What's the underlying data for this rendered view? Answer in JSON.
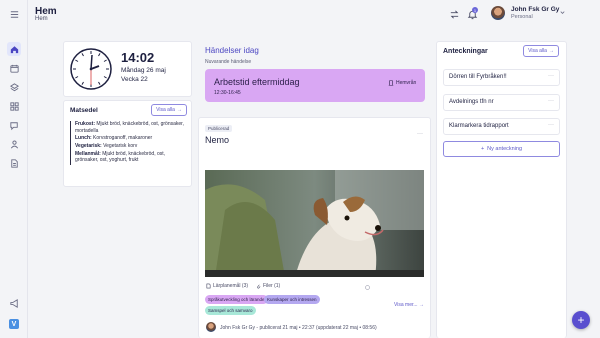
{
  "header": {
    "title": "Hem",
    "breadcrumb": "Hem",
    "notification_count": "1",
    "user_name": "John Fsk Gr Gy",
    "user_role": "Personal"
  },
  "sidebar": {
    "icons": [
      "menu-icon",
      "home-icon",
      "calendar-icon",
      "layers-icon",
      "grid-icon",
      "chat-icon",
      "people-icon",
      "document-icon",
      "megaphone-icon"
    ],
    "logo": "V"
  },
  "clock": {
    "time": "14:02",
    "date": "Måndag 26 maj",
    "week": "Vecka 22"
  },
  "menu": {
    "title": "Matsedel",
    "show_all": "Visa alla",
    "items": [
      {
        "label": "Frukost:",
        "text": " Mjukt bröd, knäckebröd, ost, grönsaker, mortadella"
      },
      {
        "label": "Lunch:",
        "text": " Korvstroganoff, makaroner"
      },
      {
        "label": "Vegetarisk:",
        "text": " Vegetarisk korv"
      },
      {
        "label": "Mellanmål:",
        "text": " Mjukt bröd, knäckebröd, ost, grönsaker, ost, yoghurt, frukt"
      }
    ]
  },
  "events": {
    "title": "Händelser idag",
    "subtitle": "Nuvarande händelse",
    "current": {
      "title": "Arbetstid eftermiddag",
      "time": "12:30-16:45",
      "room": "Hemvrån",
      "color": "#d9a7f3"
    }
  },
  "post": {
    "badge": "Publicerad",
    "title": "Nemo",
    "menu": "···",
    "lesson_plans": "Lärplanemål (3)",
    "files": "Filer (1)",
    "tags": [
      {
        "label": "Språkutveckling och lärande",
        "color": "#d9a7f3"
      },
      {
        "label": "Kunskaper och intressen",
        "color": "#b4a8f0"
      },
      {
        "label": "Samspel och samvaro",
        "color": "#a8e8d8"
      }
    ],
    "show_more": "Visa mer...",
    "author_line": "John Fsk Gr Gy - publicerat 21 maj • 22:37 (uppdaterat 22 maj • 08:56)"
  },
  "notes": {
    "title": "Anteckningar",
    "show_all": "Visa alla",
    "items": [
      {
        "title": "Dörren till Fyrbråken!!"
      },
      {
        "title": "Avdelnings tfn nr"
      },
      {
        "title": "Klarmarkera tidrapport"
      }
    ],
    "new_note": "Ny anteckning"
  },
  "fab": "+"
}
